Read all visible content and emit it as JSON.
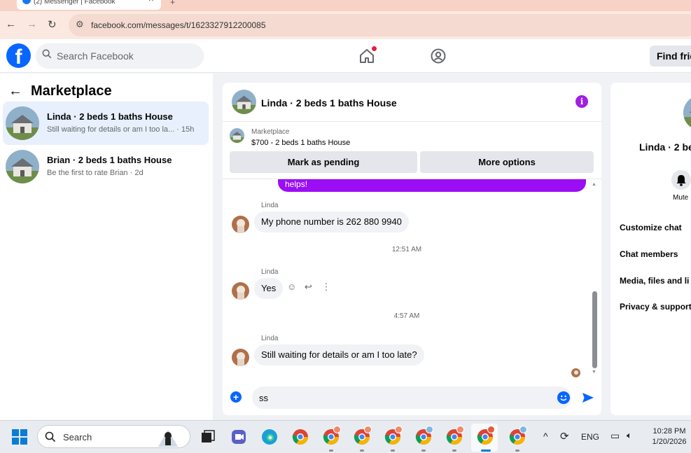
{
  "browser": {
    "tab_title": "(2) Messenger | Facebook",
    "tab_close": "✕",
    "new_tab": "+",
    "url": "facebook.com/messages/t/1623327912200085"
  },
  "header": {
    "logo": "f",
    "search_placeholder": "Search Facebook",
    "find_friends": "Find frie"
  },
  "sidebar": {
    "back": "←",
    "title": "Marketplace",
    "conversations": [
      {
        "name": "Linda · 2 beds 1 baths House",
        "snippet": "Still waiting for details or am I too la... · 15h",
        "active": true
      },
      {
        "name": "Brian · 2 beds 1 baths House",
        "snippet": "Be the first to rate Brian · 2d",
        "active": false
      }
    ]
  },
  "chat": {
    "title": "Linda · 2 beds 1 baths House",
    "info_icon": "i",
    "listing_source": "Marketplace",
    "listing_title": "$700 - 2 beds 1 baths House",
    "mark_pending": "Mark as pending",
    "more_options": "More options",
    "outgoing_partial": "helps!",
    "messages": [
      {
        "sender": "Linda",
        "text": "My phone number is 262 880 9940"
      },
      {
        "timestamp": "12:51 AM"
      },
      {
        "sender": "Linda",
        "text": "Yes"
      },
      {
        "timestamp": "4:57 AM"
      },
      {
        "sender": "Linda",
        "text": "Still waiting for details or am I too late?"
      }
    ],
    "input_value": "ss"
  },
  "details": {
    "name": "Linda · 2 be",
    "mute": "Mute",
    "items": [
      "Customize chat",
      "Chat members",
      "Media, files and li",
      "Privacy & support"
    ]
  },
  "taskbar": {
    "search_placeholder": "Search",
    "language": "ENG",
    "time": "10:28 PM",
    "date": "1/20/2026"
  },
  "colors": {
    "fb_blue": "#0866ff",
    "bubble_purple": "#9b0df5",
    "active_row": "#e7f0fc"
  }
}
